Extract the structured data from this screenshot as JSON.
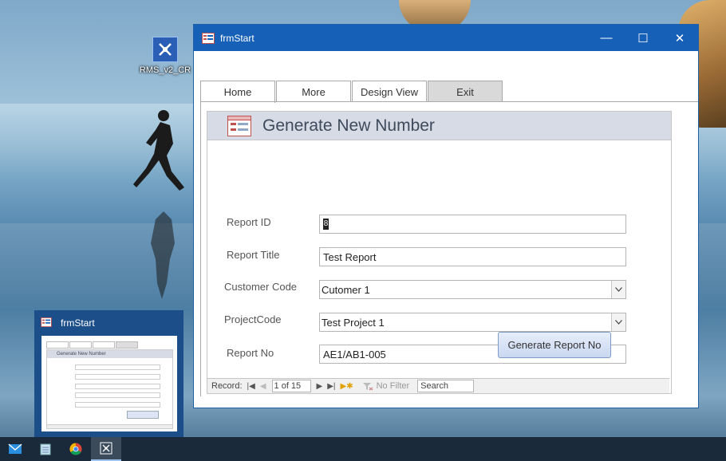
{
  "desktop": {
    "icon_label": "RMS_v2_CR"
  },
  "window": {
    "title": "frmStart",
    "controls": {
      "minimize": "—",
      "maximize": "☐",
      "close": "✕"
    }
  },
  "tabs": [
    {
      "label": "Home"
    },
    {
      "label": "More"
    },
    {
      "label": "Design View"
    },
    {
      "label": "Exit"
    }
  ],
  "form": {
    "title": "Generate New Number",
    "fields": {
      "report_id": {
        "label": "Report ID",
        "value": "8"
      },
      "report_title": {
        "label": "Report Title",
        "value": "Test Report"
      },
      "customer_code": {
        "label": "Customer Code",
        "value": "Cutomer 1"
      },
      "project_code": {
        "label": "ProjectCode",
        "value": "Test Project 1"
      },
      "report_no": {
        "label": "Report No",
        "value": "AE1/AB1-005"
      }
    },
    "generate_button": "Generate Report No"
  },
  "navigation": {
    "record_label": "Record:",
    "record_position": "1 of 15",
    "no_filter": "No Filter",
    "search_placeholder": "Search"
  },
  "preview": {
    "title": "frmStart",
    "form_title": "Generate New Number"
  }
}
